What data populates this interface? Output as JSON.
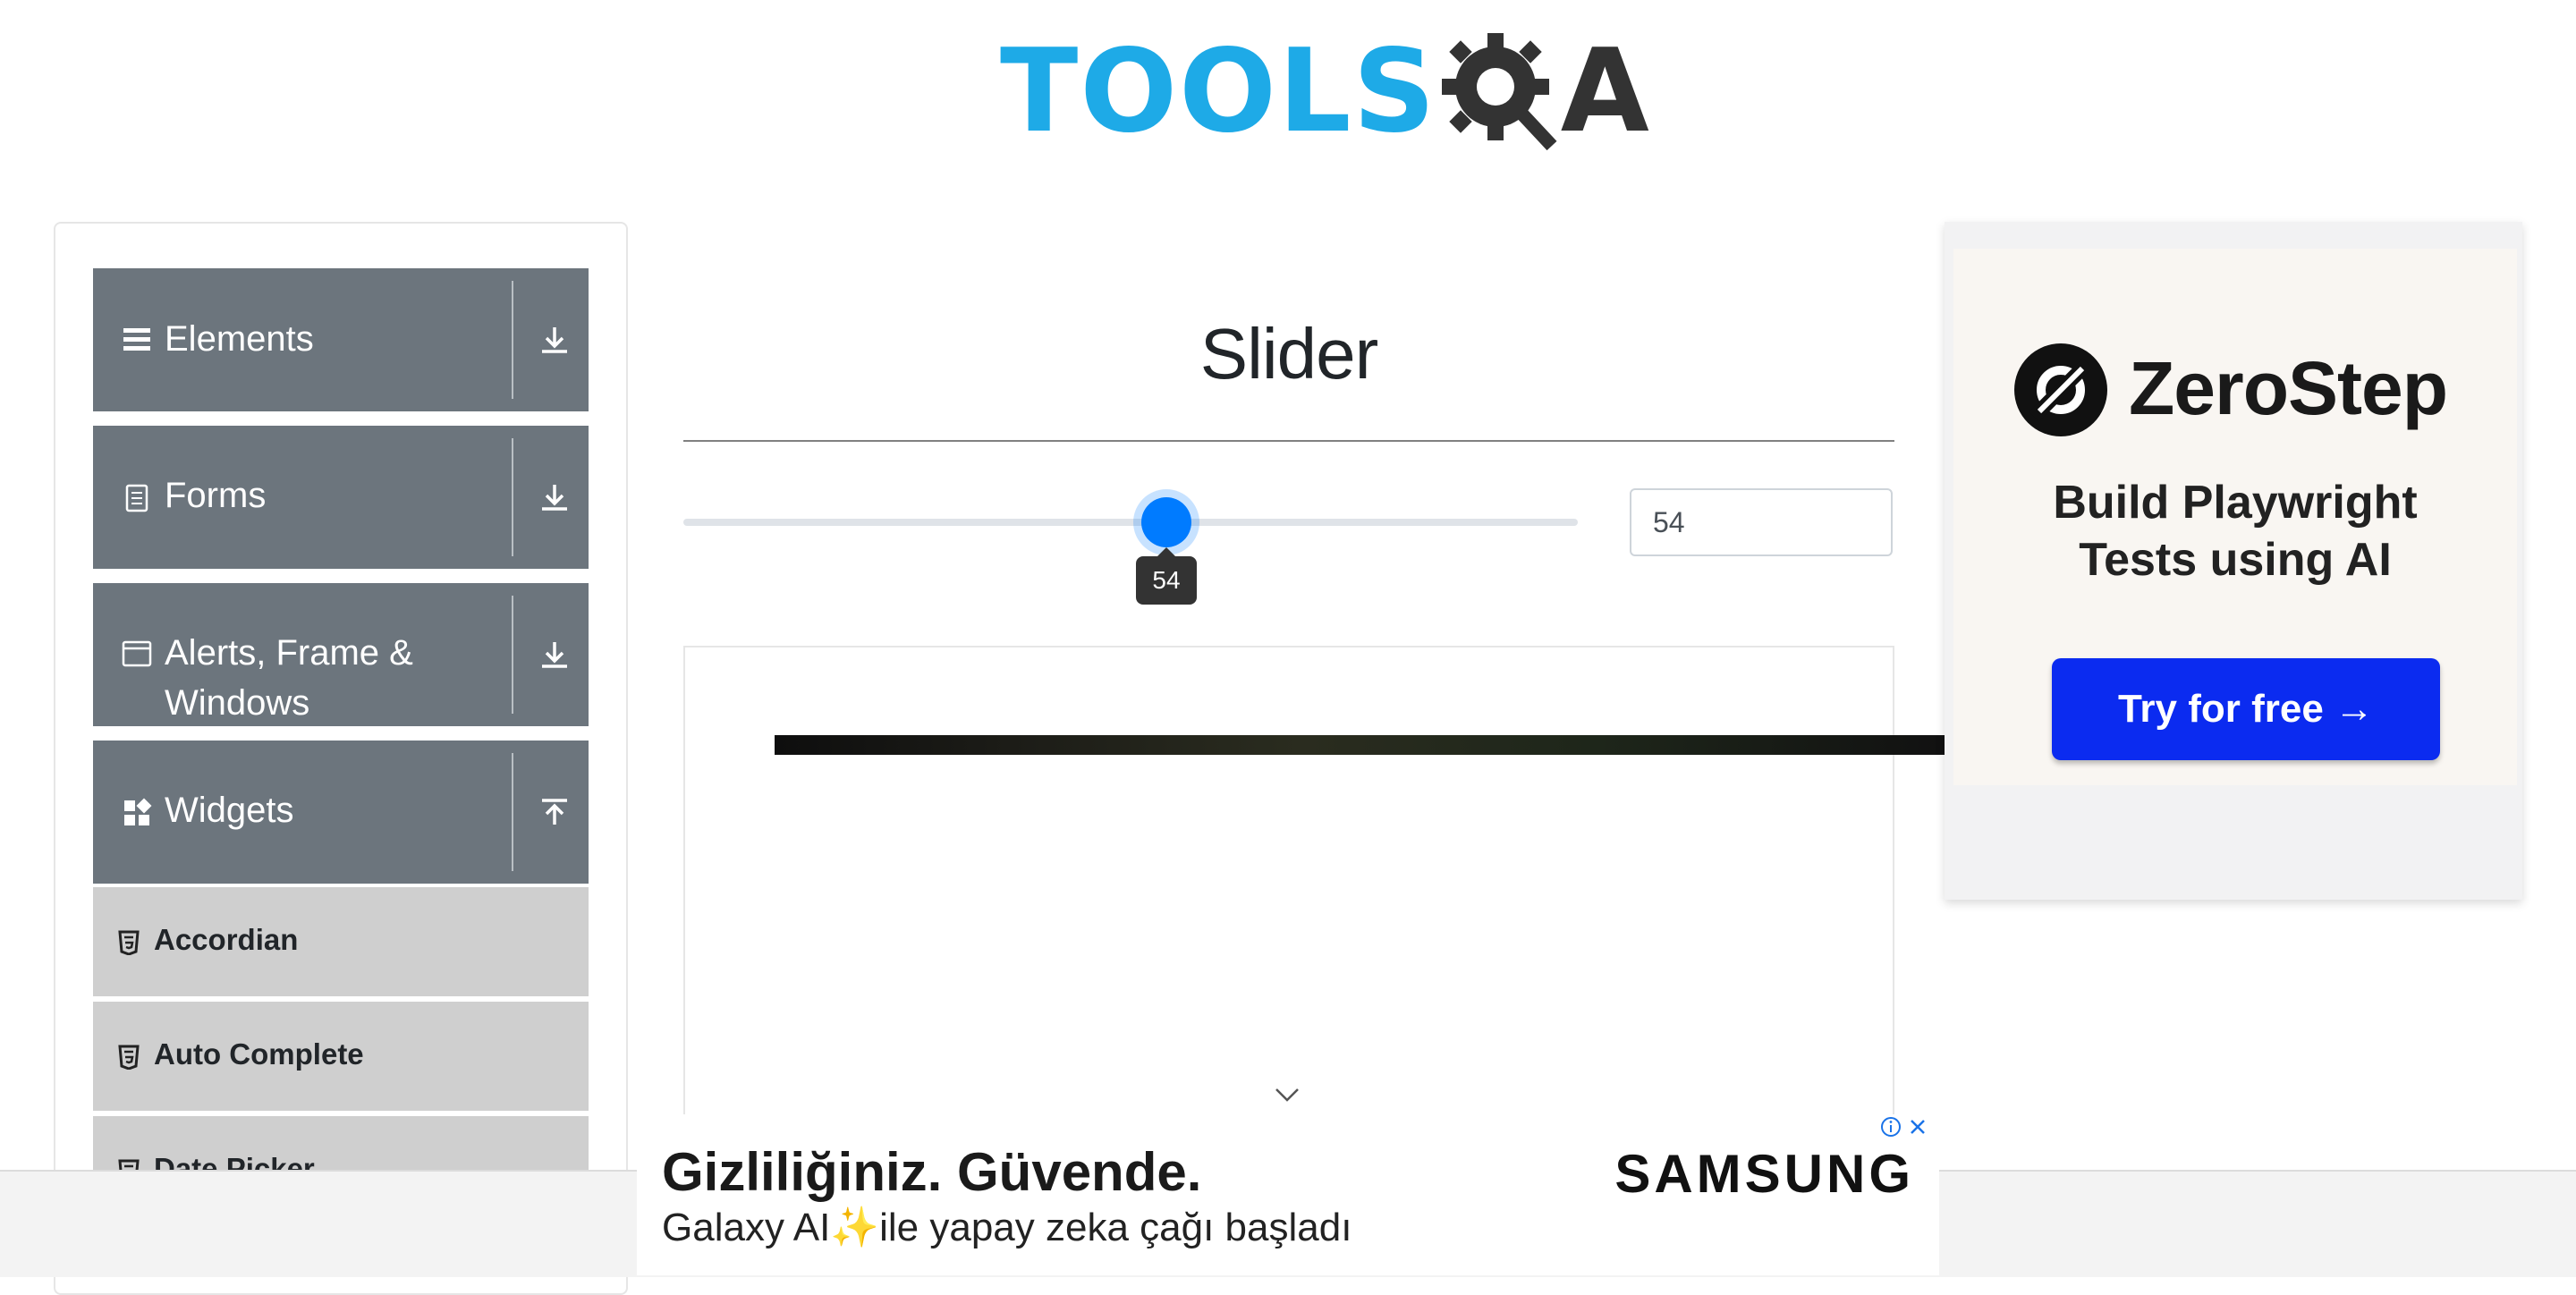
{
  "header": {
    "logo_text_tools": "TOOLS",
    "logo_text_a": "A"
  },
  "sidebar": {
    "groups": [
      {
        "label": "Elements",
        "icon": "menu-lines-icon",
        "toggle": "download-arrow-icon"
      },
      {
        "label": "Forms",
        "icon": "form-icon",
        "toggle": "download-arrow-icon"
      },
      {
        "label": "Alerts, Frame &",
        "label2": "Windows",
        "icon": "window-icon",
        "toggle": "download-arrow-icon"
      },
      {
        "label": "Widgets",
        "icon": "widgets-icon",
        "toggle": "upload-arrow-icon"
      }
    ],
    "items": [
      {
        "label": "Accordian"
      },
      {
        "label": "Auto Complete"
      },
      {
        "label": "Date Picker"
      }
    ]
  },
  "main": {
    "title": "Slider",
    "slider": {
      "value": "54",
      "min": 0,
      "max": 100,
      "tooltip": "54"
    }
  },
  "right_ad": {
    "brand": "ZeroStep",
    "tagline_line1": "Build Playwright",
    "tagline_line2": "Tests using AI",
    "button_label": "Try for free →"
  },
  "bottom_ad": {
    "headline": "Gizliliğiniz. Güvende.",
    "subline_before": "Galaxy AI",
    "subline_after": "ile yapay zeka çağı başladı",
    "brand": "SAMSUNG"
  },
  "colors": {
    "sidebar_header": "#6c757d",
    "menu_item": "#cfcfcf",
    "slider_accent": "#007bff",
    "logo_blue": "#1eaae7",
    "ad_button": "#0b2bf0"
  }
}
